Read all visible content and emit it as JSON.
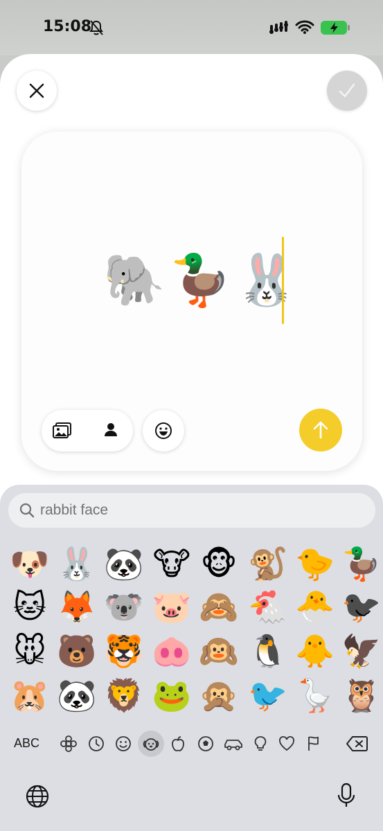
{
  "status": {
    "time": "15:08"
  },
  "composer": {
    "content": "🐘🦆🐰"
  },
  "search": {
    "query": "rabbit face"
  },
  "emoji_rows": [
    [
      "🐶",
      "🐰",
      "🐼",
      "🐮",
      "🐵",
      "🐒",
      "🐤",
      "🦆"
    ],
    [
      "🐱",
      "🦊",
      "🐨",
      "🐷",
      "🙈",
      "🐔",
      "🐣",
      "🐦‍⬛"
    ],
    [
      "🐭",
      "🐻",
      "🐯",
      "🐽",
      "🙉",
      "🐧",
      "🐥",
      "🦅"
    ],
    [
      "🐹",
      "🐼",
      "🦁",
      "🐸",
      "🙊",
      "🐦",
      "🪿",
      "🦉"
    ]
  ],
  "keyboard": {
    "abc_label": "ABC",
    "categories": [
      "smileys-symbol",
      "recent",
      "smileys",
      "animals",
      "food",
      "activity",
      "travel",
      "objects",
      "symbols",
      "flags"
    ],
    "selected_category": "animals"
  },
  "colors": {
    "accent": "#f4cd2a",
    "cursor": "#f0c419",
    "keyboard_bg": "#dcdee3"
  }
}
